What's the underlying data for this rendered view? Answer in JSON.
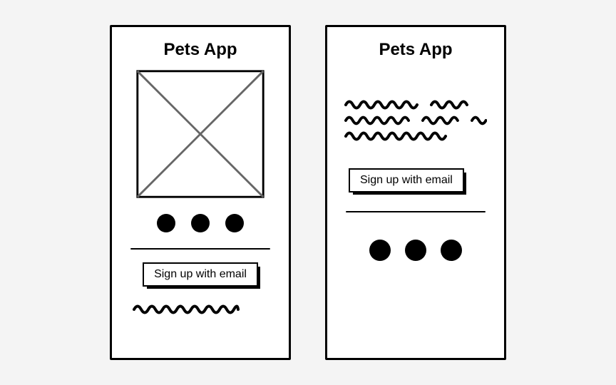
{
  "screens": [
    {
      "title": "Pets App",
      "signup_label": "Sign up with email",
      "dot_count": 3,
      "has_image_placeholder": true,
      "squiggle_lines": 1
    },
    {
      "title": "Pets App",
      "signup_label": "Sign up with email",
      "dot_count": 3,
      "has_image_placeholder": false,
      "squiggle_lines": 3
    }
  ]
}
